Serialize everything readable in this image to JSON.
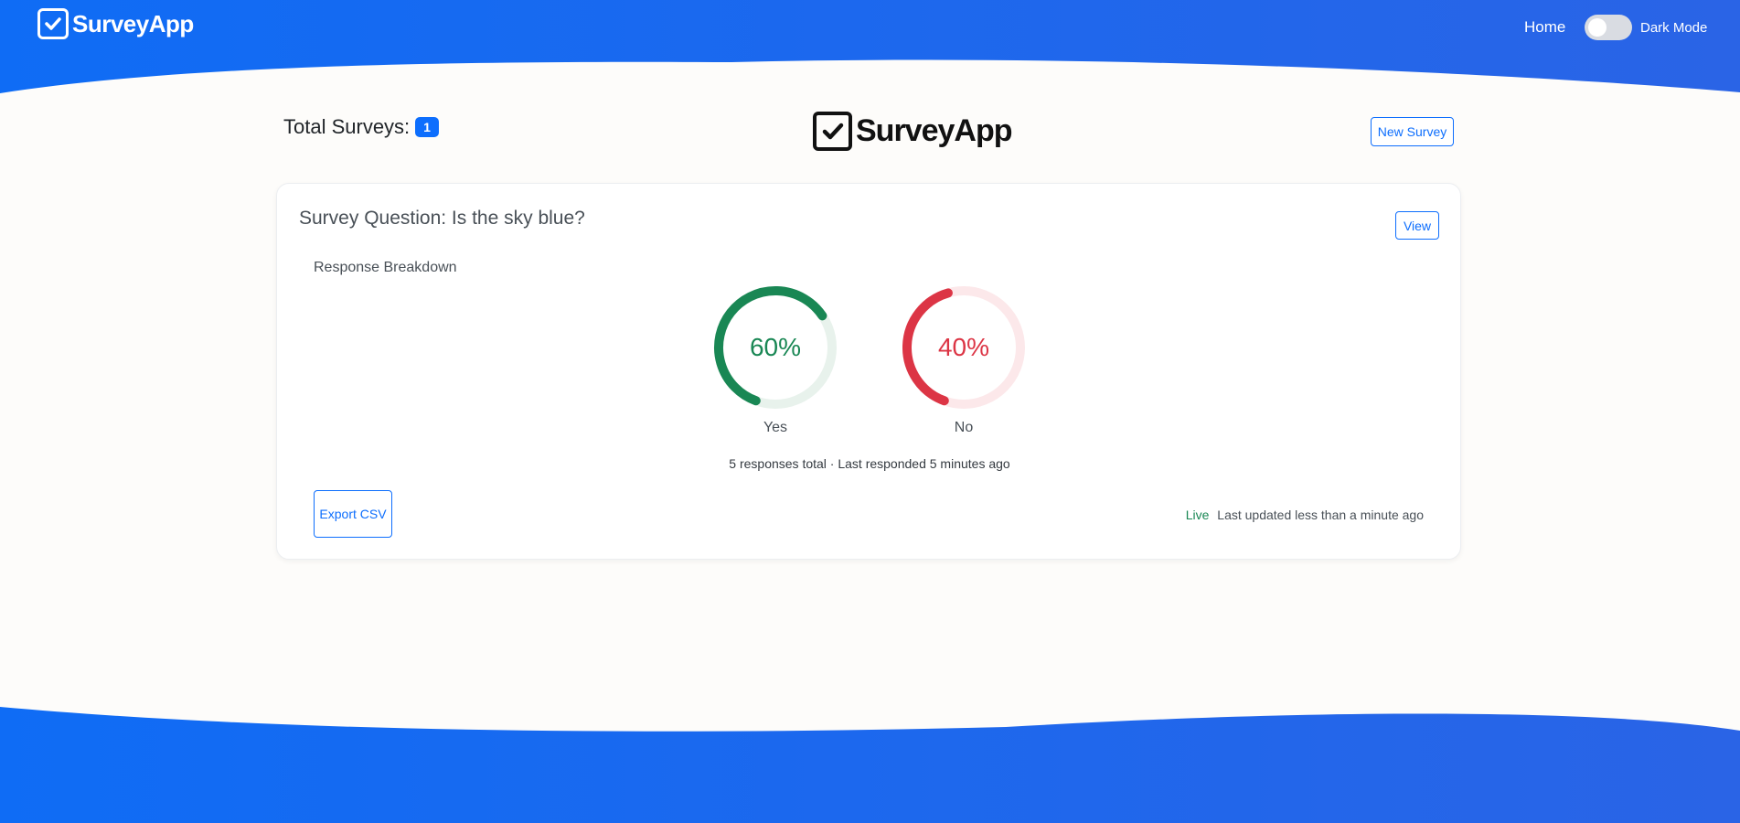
{
  "nav": {
    "brand": "SurveyApp",
    "home": "Home",
    "dark_mode_label": "Dark Mode",
    "dark_mode_on": false
  },
  "header": {
    "total_label": "Total Surveys:",
    "total_count": "1",
    "logo_text": "SurveyApp",
    "new_survey_label": "New Survey"
  },
  "survey": {
    "title": "Survey Question: Is the sky blue?",
    "view_label": "View",
    "breakdown_title": "Response Breakdown",
    "options": [
      {
        "label": "Yes",
        "percent": 60,
        "display": "60%",
        "color": "#198754",
        "track_color": "#e8f2ec"
      },
      {
        "label": "No",
        "percent": 40,
        "display": "40%",
        "color": "#dc3545",
        "track_color": "#fce8ea"
      }
    ],
    "summary": "5 responses total · Last responded 5 minutes ago",
    "export_label": "Export CSV",
    "live_label": "Live",
    "updated": "Last updated less than a minute ago"
  },
  "colors": {
    "brand_blue": "#0d6efd",
    "wave_start": "#0f6cf5",
    "wave_end": "#2a64e6"
  }
}
